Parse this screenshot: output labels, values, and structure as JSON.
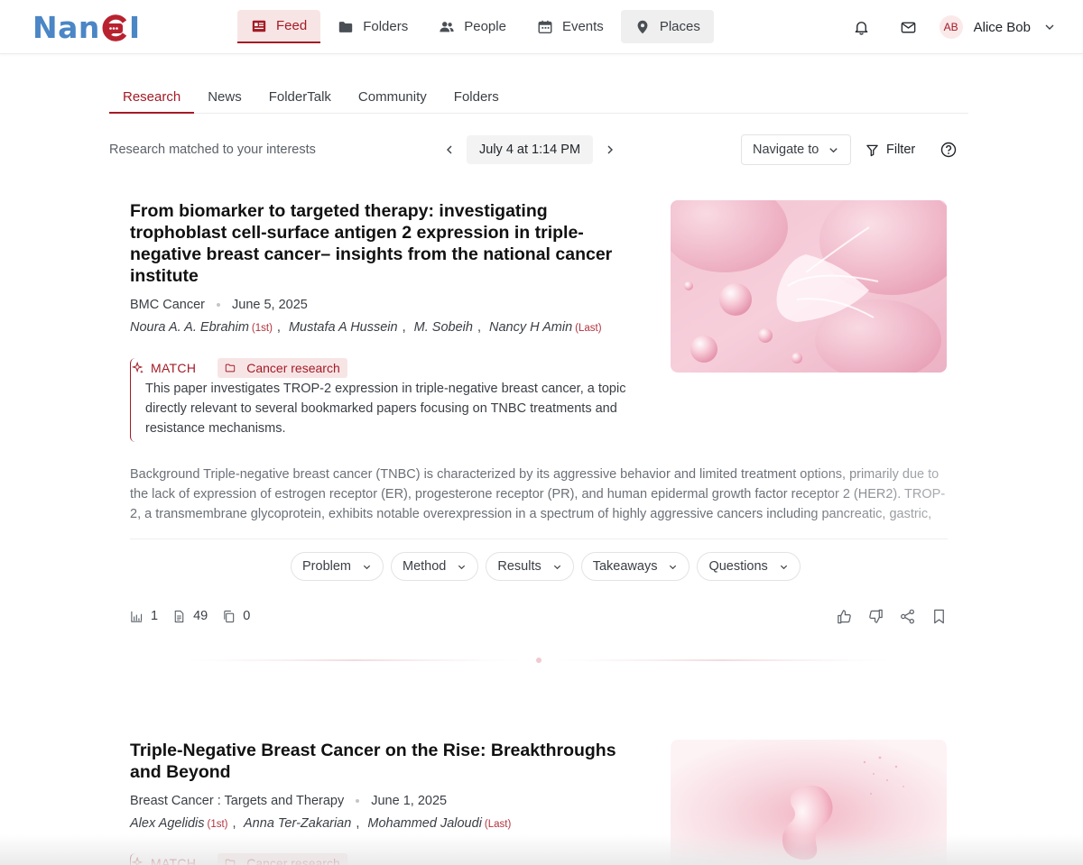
{
  "app": {
    "logo_left": "Nan",
    "logo_right": "I"
  },
  "nav": {
    "feed": "Feed",
    "folders": "Folders",
    "people": "People",
    "events": "Events",
    "places": "Places"
  },
  "user": {
    "initials": "AB",
    "name": "Alice Bob"
  },
  "subtabs": [
    "Research",
    "News",
    "FolderTalk",
    "Community",
    "Folders"
  ],
  "controls": {
    "hint": "Research matched to your interests",
    "date": "July 4 at 1:14 PM",
    "navigate": "Navigate to",
    "filter": "Filter"
  },
  "sections": [
    "Problem",
    "Method",
    "Results",
    "Takeaways",
    "Questions"
  ],
  "articles": [
    {
      "title": "From biomarker to targeted therapy: investigating trophoblast cell-surface antigen 2 expression in triple-negative breast cancer– insights from the national cancer institute",
      "journal": "BMC Cancer",
      "date": "June 5, 2025",
      "authors": [
        {
          "name": "Noura A. A. Ebrahim",
          "role": "(1st)"
        },
        {
          "name": "Mustafa A Hussein",
          "role": ""
        },
        {
          "name": "M. Sobeih",
          "role": ""
        },
        {
          "name": "Nancy H Amin",
          "role": "(Last)"
        }
      ],
      "match_label": "MATCH",
      "folder": "Cancer research",
      "match_text": "This paper investigates TROP-2 expression in triple-negative breast cancer, a topic directly relevant to several bookmarked papers focusing on TNBC treatments and resistance mechanisms.",
      "abstract": "Background Triple-negative breast cancer (TNBC) is characterized by its aggressive behavior and limited treatment options, primarily due to the lack of expression of estrogen receptor (ER), progesterone receptor (PR), and human epidermal growth factor receptor 2 (HER2). TROP-2, a transmembrane glycoprotein, exhibits notable overexpression in a spectrum of highly aggressive cancers including pancreatic, gastric, a...",
      "stats": {
        "charts": "1",
        "pages": "49",
        "copies": "0"
      }
    },
    {
      "title": "Triple-Negative Breast Cancer on the Rise: Breakthroughs and Beyond",
      "journal": "Breast Cancer : Targets and Therapy",
      "date": "June 1, 2025",
      "authors": [
        {
          "name": "Alex Agelidis",
          "role": "(1st)"
        },
        {
          "name": "Anna Ter-Zakarian",
          "role": ""
        },
        {
          "name": "Mohammed Jaloudi",
          "role": "(Last)"
        }
      ],
      "match_label": "MATCH",
      "folder": "Cancer research"
    }
  ],
  "colors": {
    "accent": "#a31b25",
    "accent_bg": "#f7e5e6",
    "logo_blue": "#4b86c6"
  },
  "icons": [
    "feed-icon",
    "folder-icon",
    "people-icon",
    "calendar-icon",
    "map-pin-icon",
    "bell-icon",
    "mail-icon",
    "chevron-down-icon",
    "chevron-left-icon",
    "chevron-right-icon",
    "filter-icon",
    "help-icon",
    "sparkle-icon",
    "bar-chart-icon",
    "document-icon",
    "copy-icon",
    "thumbs-up-icon",
    "thumbs-down-icon",
    "share-icon",
    "bookmark-icon"
  ]
}
